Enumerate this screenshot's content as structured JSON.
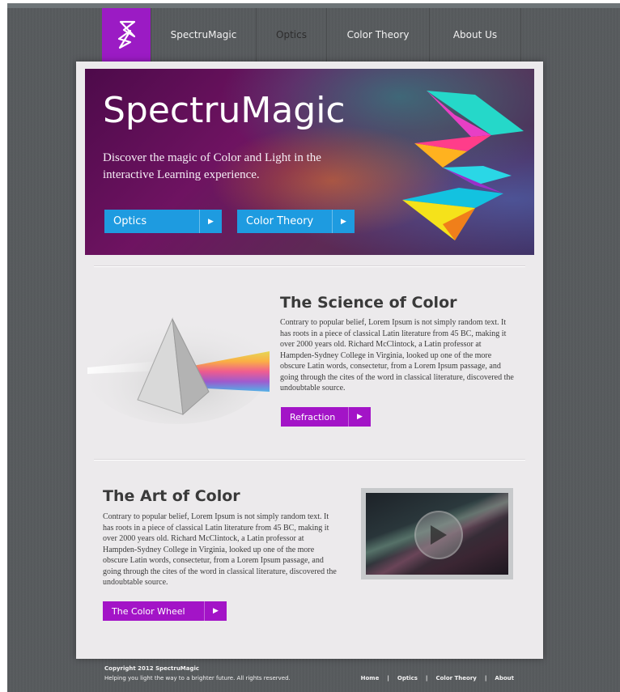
{
  "nav": {
    "items": [
      "SpectruMagic",
      "Optics",
      "Color Theory",
      "About Us"
    ]
  },
  "hero": {
    "title": "SpectruMagic",
    "subtitle": "Discover the magic of Color and Light in the interactive Learning experience.",
    "buttons": [
      "Optics",
      "Color Theory"
    ]
  },
  "science": {
    "title": "The Science of Color",
    "body": "Contrary to popular belief, Lorem Ipsum is not simply random text. It has roots in a piece of classical Latin literature from 45 BC, making it over 2000 years old. Richard McClintock, a Latin professor at Hampden-Sydney College in Virginia, looked up one of the more obscure Latin words, consectetur, from a Lorem Ipsum passage, and going through the cites of the word in classical literature, discovered the undoubtable source.",
    "button": "Refraction"
  },
  "art": {
    "title": "The Art of Color",
    "body": "Contrary to popular belief, Lorem Ipsum is not simply random text. It has roots in a piece of classical Latin literature from 45 BC, making it over 2000 years old. Richard McClintock, a Latin professor at Hampden-Sydney College in Virginia, looked up one of the more obscure Latin words, consectetur, from a Lorem Ipsum passage, and going through the cites of the word in classical literature, discovered the undoubtable source.",
    "button": "The Color Wheel"
  },
  "footer": {
    "copyright": "Copyright 2012 SpectruMagic",
    "tagline": "Helping you light the way to a brighter future. All rights reserved.",
    "links": [
      "Home",
      "Optics",
      "Color Theory",
      "About"
    ],
    "separator": "|"
  },
  "colors": {
    "brand_purple": "#9b1bc4",
    "button_blue": "#1e9be0",
    "button_purple": "#a314c7"
  },
  "icons": {
    "logo": "spectrumagic-logo-icon",
    "arrow": "play-arrow-icon",
    "video_play": "play-icon"
  }
}
